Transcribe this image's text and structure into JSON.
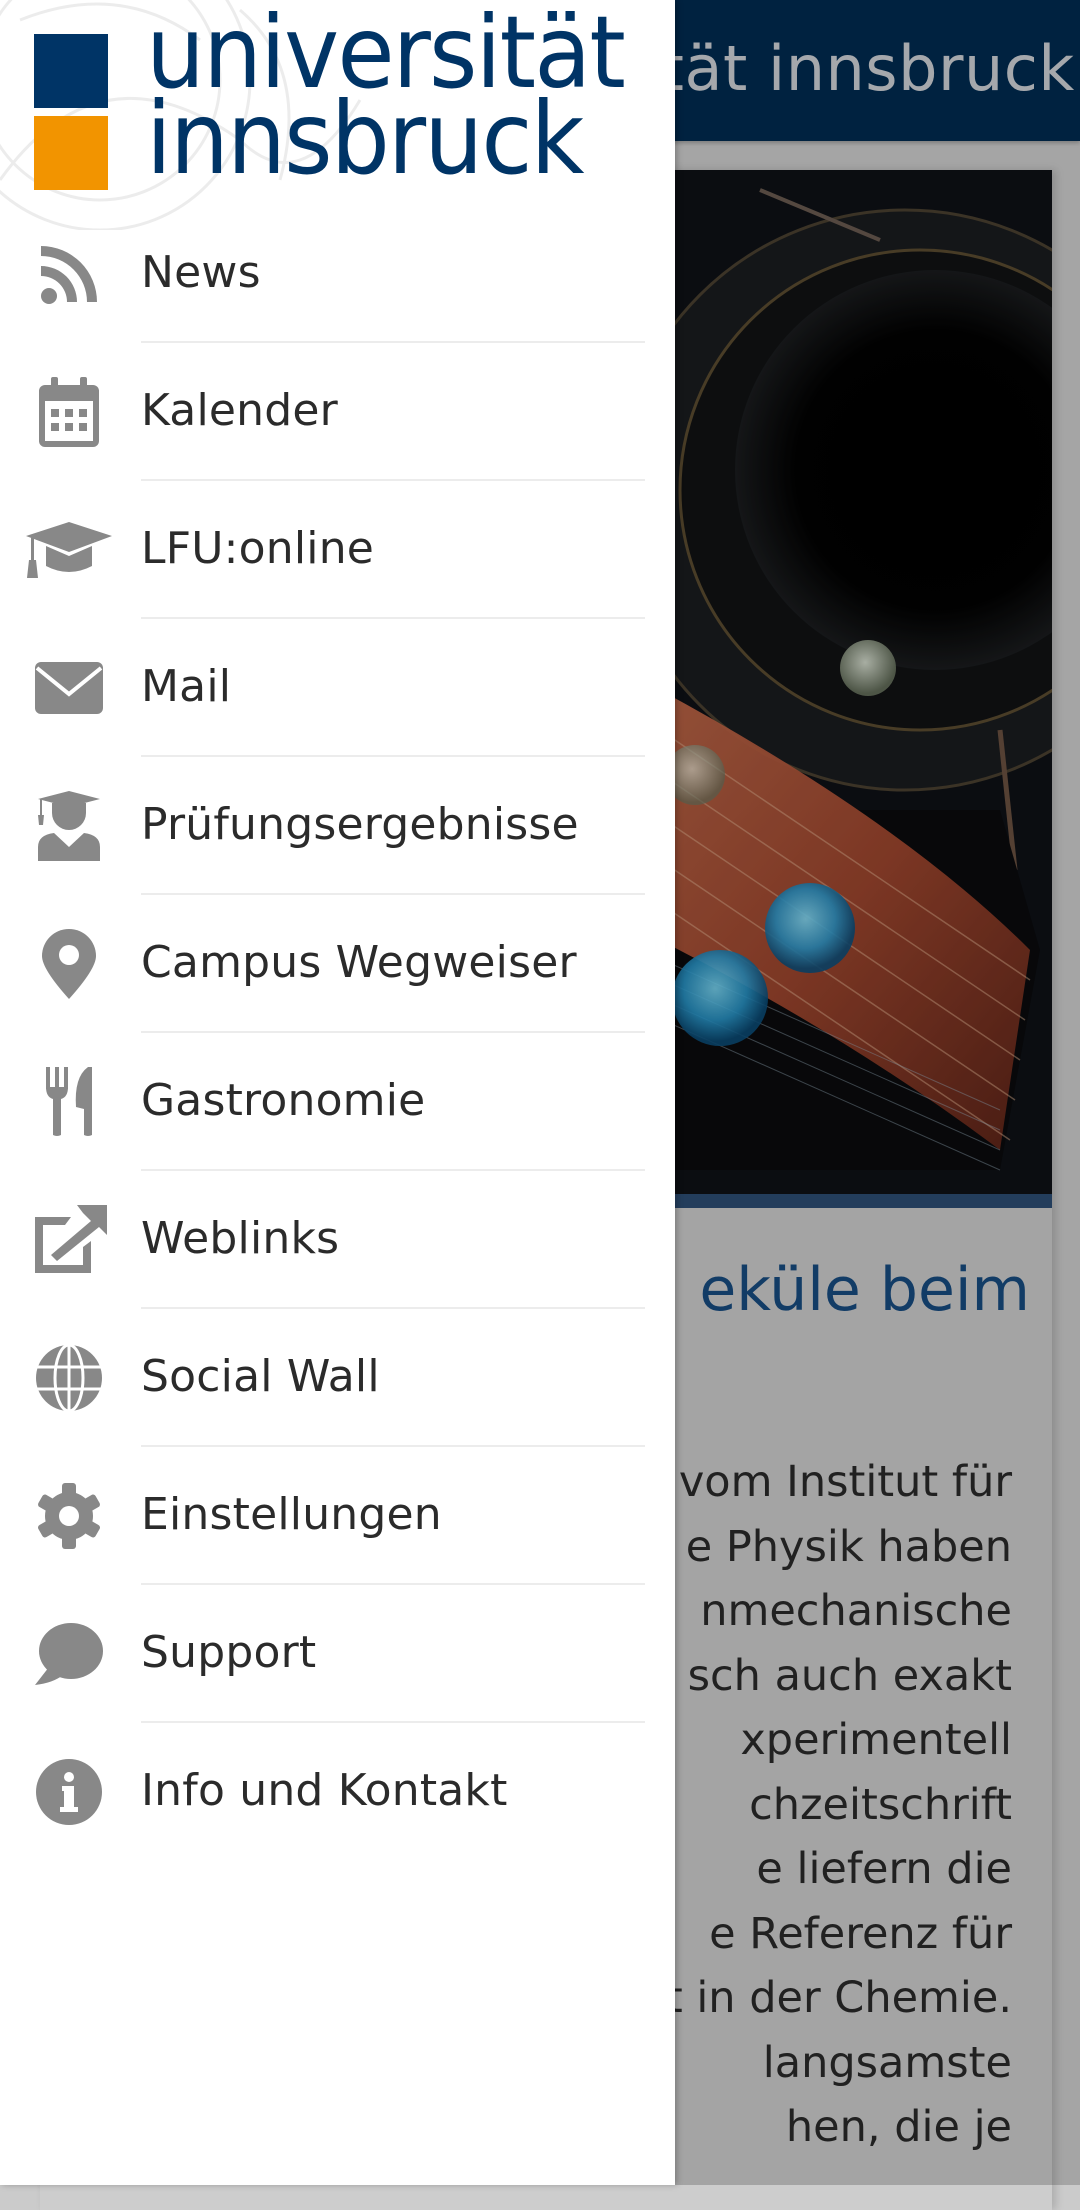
{
  "app": {
    "header_title": "universität innsbruck",
    "header_title_visible_fragment": "ruck",
    "article": {
      "title_fragment": "eküle beim",
      "text_lines": [
        "vom Institut für",
        "e Physik haben",
        "nmechanische",
        "sch auch exakt",
        "xperimentell",
        "chzeitschrift",
        "e liefern die",
        "e Referenz für",
        "t in der Chemie.",
        "langsamste",
        "hen, die je"
      ]
    }
  },
  "drawer": {
    "logo": {
      "line1": "universität",
      "line2": "innsbruck",
      "colors": {
        "blue": "#003466",
        "orange": "#f29400"
      }
    },
    "items": [
      {
        "label": "News",
        "icon": "rss-icon"
      },
      {
        "label": "Kalender",
        "icon": "calendar-icon"
      },
      {
        "label": "LFU:online",
        "icon": "graduation-cap-icon"
      },
      {
        "label": "Mail",
        "icon": "envelope-icon"
      },
      {
        "label": "Prüfungsergebnisse",
        "icon": "graduate-user-icon"
      },
      {
        "label": "Campus Wegweiser",
        "icon": "map-marker-icon"
      },
      {
        "label": "Gastronomie",
        "icon": "cutlery-icon"
      },
      {
        "label": "Weblinks",
        "icon": "external-link-icon"
      },
      {
        "label": "Social Wall",
        "icon": "globe-icon"
      },
      {
        "label": "Einstellungen",
        "icon": "gear-icon"
      },
      {
        "label": "Support",
        "icon": "chat-bubble-icon"
      },
      {
        "label": "Info und Kontakt",
        "icon": "info-icon"
      }
    ]
  },
  "colors": {
    "header_bg": "#002b50",
    "icon_gray": "#888888",
    "label_text": "#2b2b2b",
    "article_title": "#174b80"
  }
}
